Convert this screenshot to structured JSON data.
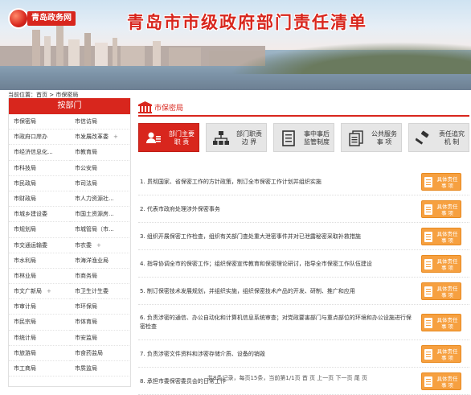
{
  "header": {
    "logo_text": "青岛政务网",
    "title": "青岛市市级政府部门责任清单"
  },
  "breadcrumb": {
    "label": "当前位置：",
    "home": "首页",
    "sep": ">",
    "current": "市保密局"
  },
  "sidebar": {
    "title": "按部门",
    "items": [
      {
        "label": "市保密局",
        "plus": ""
      },
      {
        "label": "市信访局",
        "plus": ""
      },
      {
        "label": "市政府口岸办",
        "plus": ""
      },
      {
        "label": "市发展改革委",
        "plus": "+"
      },
      {
        "label": "市经济信息化...",
        "plus": ""
      },
      {
        "label": "市教育局",
        "plus": ""
      },
      {
        "label": "市科技局",
        "plus": ""
      },
      {
        "label": "市公安局",
        "plus": ""
      },
      {
        "label": "市民政局",
        "plus": ""
      },
      {
        "label": "市司法局",
        "plus": ""
      },
      {
        "label": "市财政局",
        "plus": ""
      },
      {
        "label": "市人力资源社...",
        "plus": ""
      },
      {
        "label": "市城乡建设委",
        "plus": ""
      },
      {
        "label": "市国土资源房...",
        "plus": ""
      },
      {
        "label": "市规划局",
        "plus": ""
      },
      {
        "label": "市城管局（市...",
        "plus": ""
      },
      {
        "label": "市交通运输委",
        "plus": ""
      },
      {
        "label": "市农委",
        "plus": "+"
      },
      {
        "label": "市水利局",
        "plus": ""
      },
      {
        "label": "市海洋渔业局",
        "plus": ""
      },
      {
        "label": "市林业局",
        "plus": ""
      },
      {
        "label": "市商务局",
        "plus": ""
      },
      {
        "label": "市文广新局",
        "plus": "+"
      },
      {
        "label": "市卫生计生委",
        "plus": ""
      },
      {
        "label": "市审计局",
        "plus": ""
      },
      {
        "label": "市环保局",
        "plus": ""
      },
      {
        "label": "市民宗局",
        "plus": ""
      },
      {
        "label": "市体育局",
        "plus": ""
      },
      {
        "label": "市统计局",
        "plus": ""
      },
      {
        "label": "市安监局",
        "plus": ""
      },
      {
        "label": "市旅游局",
        "plus": ""
      },
      {
        "label": "市食药监局",
        "plus": ""
      },
      {
        "label": "市工商局",
        "plus": ""
      },
      {
        "label": "市质监局",
        "plus": ""
      }
    ]
  },
  "main": {
    "department": "市保密局",
    "tabs": [
      {
        "line1": "部门主要",
        "line2": "职  责",
        "active": true,
        "icon": "people-icon"
      },
      {
        "line1": "部门职责",
        "line2": "边  界",
        "active": false,
        "icon": "org-chart-icon"
      },
      {
        "line1": "事中事后",
        "line2": "监管制度",
        "active": false,
        "icon": "document-icon"
      },
      {
        "line1": "公共服务",
        "line2": "事  项",
        "active": false,
        "icon": "stack-docs-icon"
      },
      {
        "line1": "责任追究",
        "line2": "机  制",
        "active": false,
        "icon": "gavel-icon"
      }
    ],
    "duties": [
      "1. 贯彻国家、省保密工作的方针政策，制订全市保密工作计划并组织实施",
      "2. 代表市政府处理涉外保密事务",
      "3. 组织开展保密工作检查，组织有关部门查处重大泄密事件并对已泄露秘密采取补救措施",
      "4. 指导协调全市的保密工作；组织保密宣传教育和保密理论研讨，指导全市保密工作队伍建设",
      "5. 制订保密技术发展规划，并组织实施，组织保密技术产品的开发、研制、推广和应用",
      "6. 负责涉密的通信、办公自动化和计算机信息系统审查；对党政要害部门与重点部位的环境和办公设施进行保密检查",
      "7. 负责涉密文件资料和涉密存储介质、设备的销毁",
      "8. 承担市委保密委员会的日常工作"
    ],
    "detail_button": {
      "line1": "具体责任",
      "line2": "事  项"
    },
    "pager": "共8条记录，每页15条，当前第1/1页 首 页  上一页 下一页 尾 页"
  },
  "colors": {
    "brand_red": "#d8261d",
    "button_orange": "#f6a040"
  }
}
